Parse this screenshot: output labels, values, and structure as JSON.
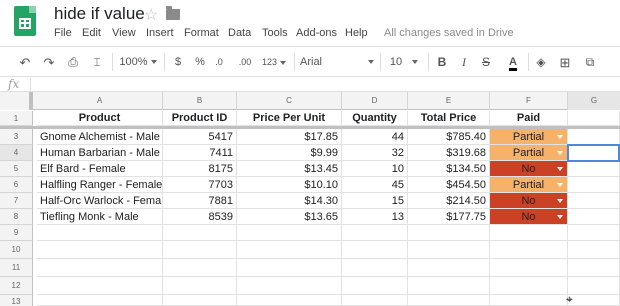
{
  "app": {
    "title": "hide if value",
    "saved_status": "All changes saved in Drive",
    "menu": [
      "File",
      "Edit",
      "View",
      "Insert",
      "Format",
      "Data",
      "Tools",
      "Add-ons",
      "Help"
    ]
  },
  "toolbar": {
    "zoom": "100%",
    "currency": "$",
    "percent": "%",
    "dec_less": ".0",
    ".dec_more": ".00",
    "dec_more": ".00",
    "more_formats": "123",
    "font": "Arial",
    "font_size": "10",
    "bold": "B",
    "italic": "I",
    "strike": "S",
    "text_color": "A"
  },
  "formula_bar": {
    "fx": "fx",
    "value": ""
  },
  "sheet": {
    "columns": [
      "A",
      "B",
      "C",
      "D",
      "E",
      "F",
      "G"
    ],
    "row_numbers": [
      "1",
      "3",
      "4",
      "5",
      "6",
      "7",
      "8",
      "9",
      "10",
      "11",
      "12",
      "13"
    ],
    "headers": [
      "Product",
      "Product ID",
      "Price Per Unit",
      "Quantity",
      "Total Price",
      "Paid"
    ],
    "rows": [
      [
        "Gnome Alchemist - Male",
        "5417",
        "$17.85",
        "44",
        "$785.40",
        "Partial"
      ],
      [
        "Human Barbarian - Male",
        "7411",
        "$9.99",
        "32",
        "$319.68",
        "Partial"
      ],
      [
        "Elf Bard - Female",
        "8175",
        "$13.45",
        "10",
        "$134.50",
        "No"
      ],
      [
        "Halfling Ranger - Female",
        "7703",
        "$10.10",
        "45",
        "$454.50",
        "Partial"
      ],
      [
        "Half-Orc Warlock - Female",
        "7881",
        "$14.30",
        "15",
        "$214.50",
        "No"
      ],
      [
        "Tiefling Monk - Male",
        "8539",
        "$13.65",
        "13",
        "$177.75",
        "No"
      ]
    ],
    "colors": {
      "partial": "#f6b26b",
      "no": "#cc4125",
      "selection": "#4a89dc"
    }
  }
}
